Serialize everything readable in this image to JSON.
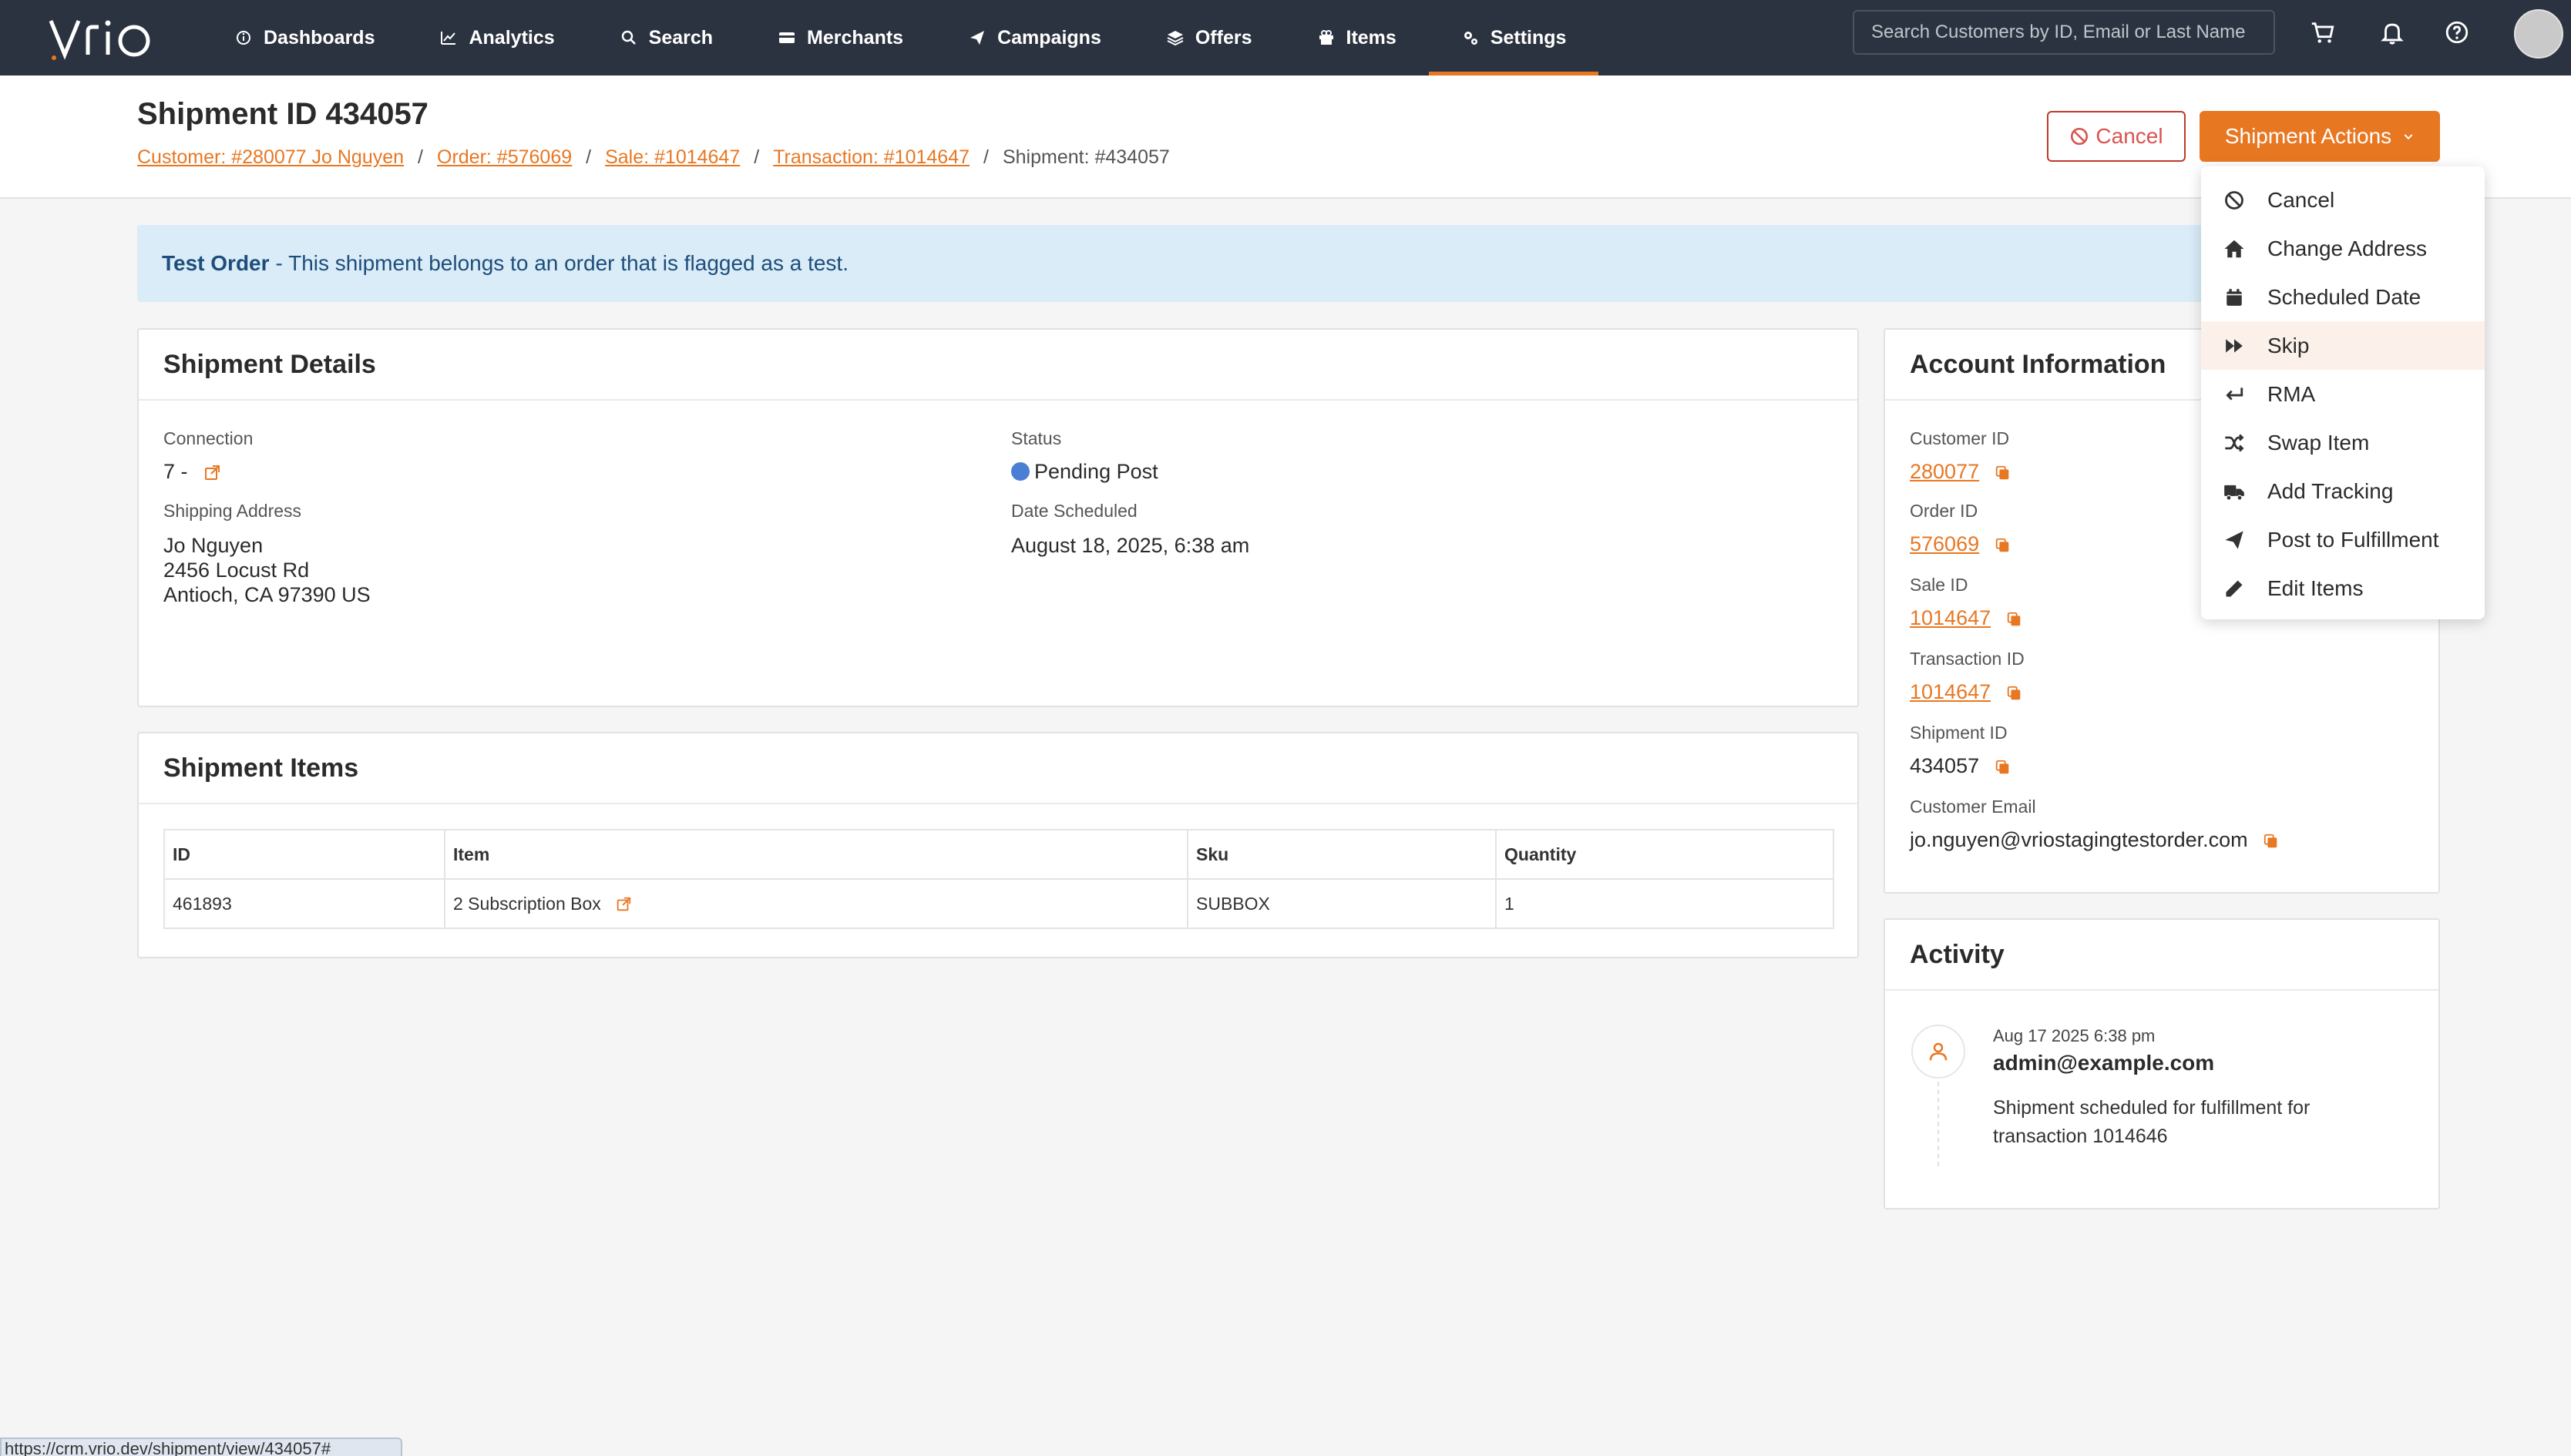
{
  "nav": {
    "logo": "VRIO",
    "links": [
      {
        "label": "Dashboards",
        "icon": "info-circle-icon"
      },
      {
        "label": "Analytics",
        "icon": "line-chart-icon"
      },
      {
        "label": "Search",
        "icon": "search-icon"
      },
      {
        "label": "Merchants",
        "icon": "card-icon"
      },
      {
        "label": "Campaigns",
        "icon": "paper-plane-icon"
      },
      {
        "label": "Offers",
        "icon": "layers-icon"
      },
      {
        "label": "Items",
        "icon": "gift-icon"
      },
      {
        "label": "Settings",
        "icon": "gears-icon",
        "active": true
      }
    ],
    "search_placeholder": "Search Customers by ID, Email or Last Name",
    "accent": "#e87722",
    "bg": "#2b3340"
  },
  "header": {
    "title": "Shipment ID 434057",
    "breadcrumbs": [
      "Customer: #280077 Jo Nguyen",
      "Order: #576069",
      "Sale: #1014647",
      "Transaction: #1014647"
    ],
    "current": "Shipment: #434057",
    "cancel_label": "Cancel",
    "actions_label": "Shipment Actions"
  },
  "alert": {
    "strong": "Test Order",
    "text": "- This shipment belongs to an order that is flagged as a test."
  },
  "shipment_details": {
    "title": "Shipment Details",
    "connection_label": "Connection",
    "connection_value": "7 -",
    "status_label": "Status",
    "status_value": "Pending Post",
    "status_color": "#4a7fd4",
    "address_label": "Shipping Address",
    "address_lines": [
      "Jo Nguyen",
      "2456 Locust Rd",
      "Antioch, CA 97390 US"
    ],
    "date_label": "Date Scheduled",
    "date_value": "August 18, 2025, 6:38 am"
  },
  "shipment_items": {
    "title": "Shipment Items",
    "columns": [
      "ID",
      "Item",
      "Sku",
      "Quantity"
    ],
    "rows": [
      {
        "id": "461893",
        "item": "2 Subscription Box",
        "sku": "SUBBOX",
        "qty": "1"
      }
    ]
  },
  "account": {
    "title": "Account Information",
    "customer_id_label": "Customer ID",
    "customer_id": "280077",
    "order_id_label": "Order ID",
    "order_id": "576069",
    "sale_id_label": "Sale ID",
    "sale_id": "1014647",
    "transaction_id_label": "Transaction ID",
    "transaction_id": "1014647",
    "shipment_id_label": "Shipment ID",
    "shipment_id": "434057",
    "email_label": "Customer Email",
    "email": "jo.nguyen@vriostagingtestorder.com"
  },
  "activity": {
    "title": "Activity",
    "time": "Aug 17 2025 6:38 pm",
    "user": "admin@example.com",
    "message_lines": [
      "Shipment scheduled for fulfillment for",
      "transaction 1014646"
    ]
  },
  "dropdown": {
    "items": [
      {
        "label": "Cancel",
        "icon": "ban-icon"
      },
      {
        "label": "Change Address",
        "icon": "home-icon"
      },
      {
        "label": "Scheduled Date",
        "icon": "calendar-icon"
      },
      {
        "label": "Skip",
        "icon": "fast-forward-icon",
        "hover": true
      },
      {
        "label": "RMA",
        "icon": "return-arrow-icon"
      },
      {
        "label": "Swap Item",
        "icon": "shuffle-icon"
      },
      {
        "label": "Add Tracking",
        "icon": "truck-icon"
      },
      {
        "label": "Post to Fulfillment",
        "icon": "paper-plane-icon"
      },
      {
        "label": "Edit Items",
        "icon": "pencil-icon"
      }
    ]
  },
  "statusbar": {
    "url": "https://crm.vrio.dev/shipment/view/434057#"
  }
}
